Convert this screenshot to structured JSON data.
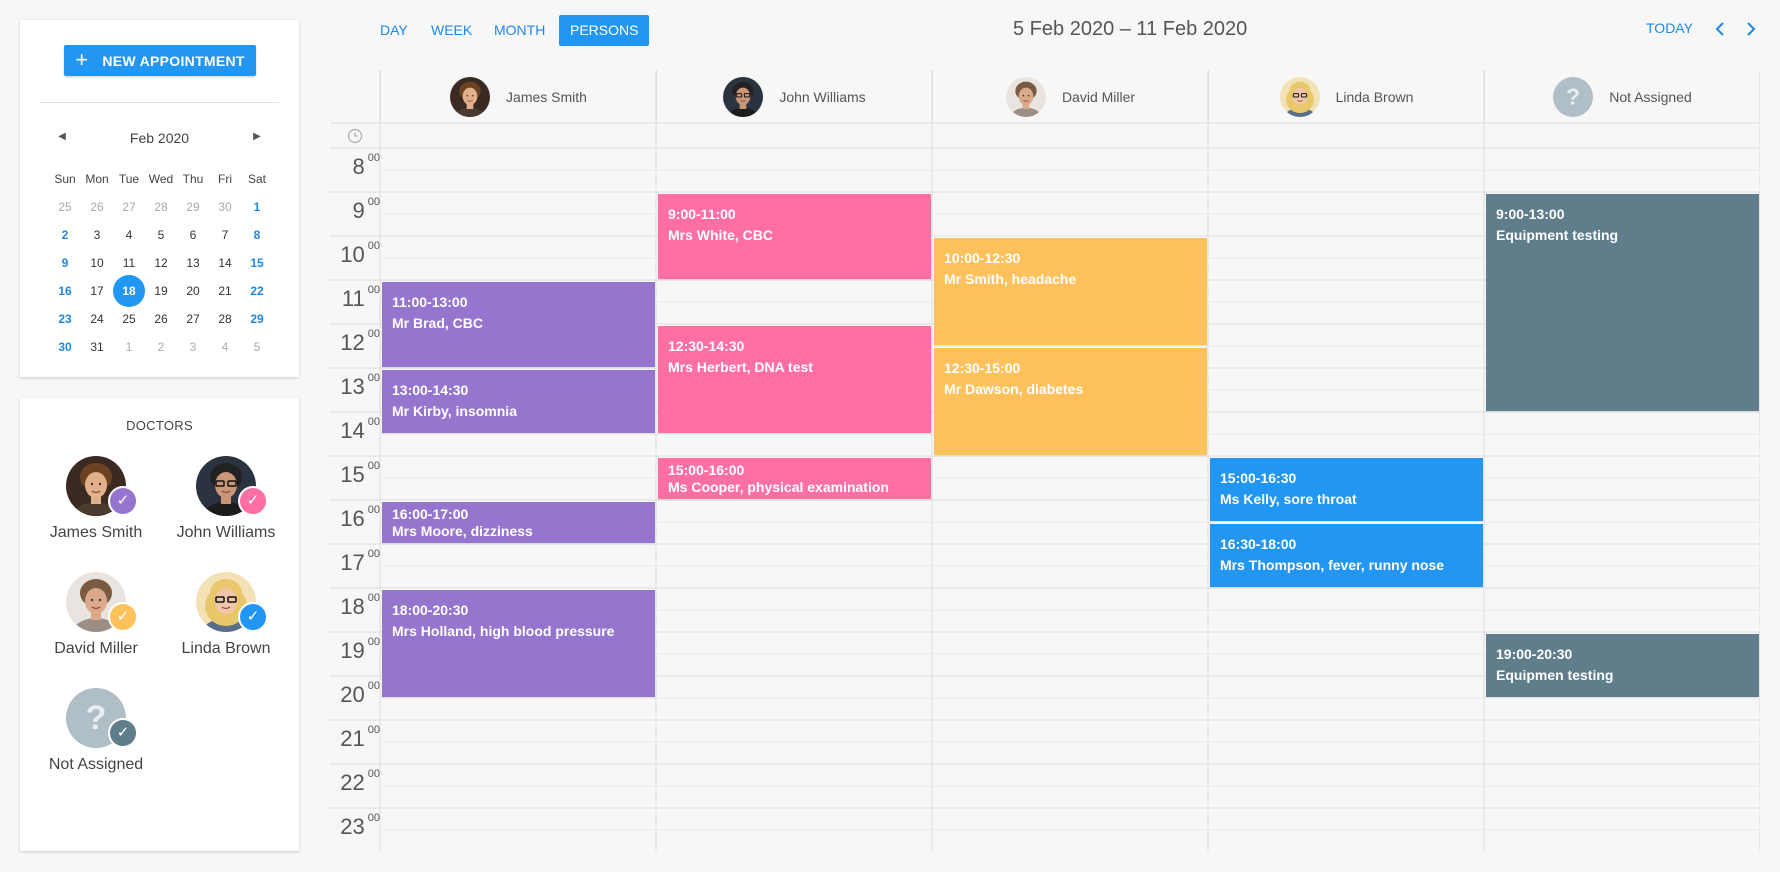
{
  "sidebar": {
    "new_appointment_label": "NEW APPOINTMENT",
    "mini_calendar": {
      "month_label": "Feb 2020",
      "weekdays": [
        "Sun",
        "Mon",
        "Tue",
        "Wed",
        "Thu",
        "Fri",
        "Sat"
      ],
      "weeks": [
        [
          "25",
          "26",
          "27",
          "28",
          "29",
          "30",
          "1"
        ],
        [
          "2",
          "3",
          "4",
          "5",
          "6",
          "7",
          "8"
        ],
        [
          "9",
          "10",
          "11",
          "12",
          "13",
          "14",
          "15"
        ],
        [
          "16",
          "17",
          "18",
          "19",
          "20",
          "21",
          "22"
        ],
        [
          "23",
          "24",
          "25",
          "26",
          "27",
          "28",
          "29"
        ],
        [
          "30",
          "31",
          "1",
          "2",
          "3",
          "4",
          "5"
        ]
      ],
      "today": "18"
    },
    "doctors_title": "DOCTORS",
    "doctors": [
      {
        "name": "James Smith",
        "color": "#9575cd"
      },
      {
        "name": "John Williams",
        "color": "#ff6fa4"
      },
      {
        "name": "David Miller",
        "color": "#ffc15c"
      },
      {
        "name": "Linda Brown",
        "color": "#2196f3"
      },
      {
        "name": "Not Assigned",
        "color": "#607d8b"
      }
    ]
  },
  "toolbar": {
    "views": [
      "DAY",
      "WEEK",
      "MONTH",
      "PERSONS"
    ],
    "active_view": "PERSONS",
    "range_title": "5 Feb 2020 – 11 Feb 2020",
    "today_label": "TODAY"
  },
  "scheduler": {
    "columns": [
      "James Smith",
      "John Williams",
      "David Miller",
      "Linda Brown",
      "Not Assigned"
    ],
    "hours": [
      "8",
      "9",
      "10",
      "11",
      "12",
      "13",
      "14",
      "15",
      "16",
      "17",
      "18",
      "19",
      "20",
      "21",
      "22",
      "23"
    ],
    "minutes_label": "00",
    "appointments": [
      {
        "col": 0,
        "start": 11,
        "end": 13,
        "time": "11:00-13:00",
        "title": "Mr Brad, CBC",
        "color": "#9575cd"
      },
      {
        "col": 0,
        "start": 13,
        "end": 14.5,
        "time": "13:00-14:30",
        "title": "Mr Kirby, insomnia",
        "color": "#9575cd"
      },
      {
        "col": 0,
        "start": 16,
        "end": 17,
        "time": "16:00-17:00",
        "title": "Mrs Moore, dizziness",
        "color": "#9575cd"
      },
      {
        "col": 0,
        "start": 18,
        "end": 20.5,
        "time": "18:00-20:30",
        "title": "Mrs Holland, high blood pressure",
        "color": "#9575cd"
      },
      {
        "col": 1,
        "start": 9,
        "end": 11,
        "time": "9:00-11:00",
        "title": "Mrs White, CBC",
        "color": "#ff6fa4"
      },
      {
        "col": 1,
        "start": 12,
        "end": 14.5,
        "time": "12:30-14:30",
        "title": "Mrs Herbert, DNA test",
        "color": "#ff6fa4"
      },
      {
        "col": 1,
        "start": 15,
        "end": 16,
        "time": "15:00-16:00",
        "title": "Ms Cooper, physical examination",
        "color": "#ff6fa4"
      },
      {
        "col": 2,
        "start": 10,
        "end": 12.5,
        "time": "10:00-12:30",
        "title": "Mr Smith, headache",
        "color": "#ffc15c"
      },
      {
        "col": 2,
        "start": 12.5,
        "end": 15,
        "time": "12:30-15:00",
        "title": "Mr Dawson, diabetes",
        "color": "#ffc15c"
      },
      {
        "col": 3,
        "start": 15,
        "end": 16.5,
        "time": "15:00-16:30",
        "title": "Ms Kelly, sore throat",
        "color": "#2196f3"
      },
      {
        "col": 3,
        "start": 16.5,
        "end": 18,
        "time": "16:30-18:00",
        "title": "Mrs Thompson, fever, runny nose",
        "color": "#2196f3"
      },
      {
        "col": 4,
        "start": 9,
        "end": 14,
        "time": "9:00-13:00",
        "title": "Equipment testing",
        "color": "#607d8b"
      },
      {
        "col": 4,
        "start": 19,
        "end": 20.5,
        "time": "19:00-20:30",
        "title": "Equipmen testing",
        "color": "#607d8b"
      }
    ]
  },
  "icons": {
    "add": "plus-icon",
    "prev": "chevron-left-icon",
    "next": "chevron-right-icon",
    "clock": "clock-icon",
    "check": "check-icon",
    "unknown": "question-icon"
  }
}
